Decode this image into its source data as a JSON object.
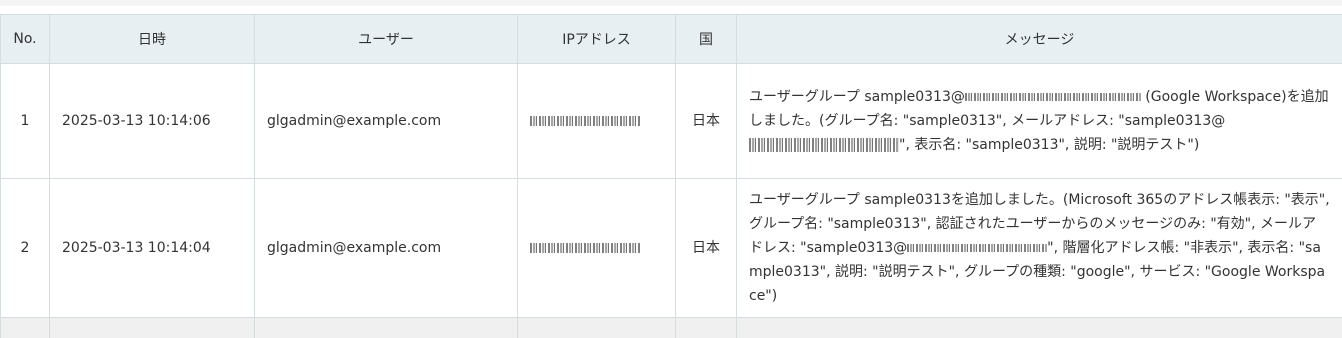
{
  "columns": {
    "no": "No.",
    "datetime": "日時",
    "user": "ユーザー",
    "ip": "IPアドレス",
    "country": "国",
    "message": "メッセージ"
  },
  "rows": [
    {
      "no": "1",
      "datetime": "2025-03-13 10:14:06",
      "user": "glgadmin@example.com",
      "country": "日本",
      "message": {
        "part1": "ユーザーグループ sample0313@",
        "part2": " (Google Workspace)を追加しました。(グループ名: \"sample0313\", メールアドレス: \"sample0313@",
        "part3": "\", 表示名: \"sample0313\", 説明: \"説明テスト\")"
      }
    },
    {
      "no": "2",
      "datetime": "2025-03-13 10:14:04",
      "user": "glgadmin@example.com",
      "country": "日本",
      "message": {
        "part1": "ユーザーグループ sample0313を追加しました。(Microsoft 365のアドレス帳表示: \"表示\", グループ名: \"sample0313\", 認証されたユーザーからのメッセージのみ: \"有効\", メールアドレス: \"sample0313@",
        "part2": "\", 階層化アドレス帳: \"非表示\", 表示名: \"sample0313\", 説明: \"説明テスト\", グループの種類: \"google\", サービス: \"Google Workspace\")"
      }
    }
  ]
}
